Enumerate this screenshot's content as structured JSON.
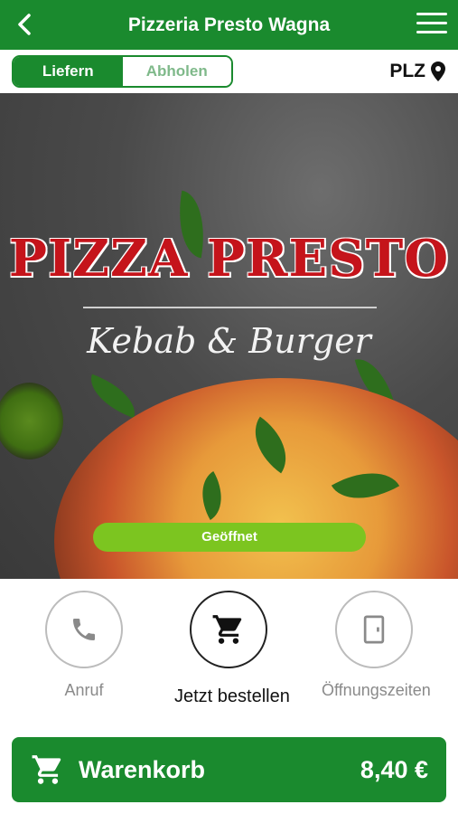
{
  "header": {
    "title": "Pizzeria Presto Wagna",
    "back_icon": "chevron-left-icon",
    "menu_icon": "hamburger-menu-icon"
  },
  "mode_toggle": {
    "options": [
      {
        "label": "Liefern",
        "active": true
      },
      {
        "label": "Abholen",
        "active": false
      }
    ]
  },
  "postal_code": {
    "label": "PLZ",
    "icon": "location-pin-icon"
  },
  "hero": {
    "logo_title": "PIZZA PRESTO",
    "logo_subtitle": "Kebab & Burger",
    "status": "Geöffnet"
  },
  "actions": [
    {
      "label": "Anruf",
      "icon": "phone-icon"
    },
    {
      "label": "Jetzt bestellen",
      "icon": "shopping-cart-icon"
    },
    {
      "label": "Öffnungszeiten",
      "icon": "door-icon"
    }
  ],
  "cart": {
    "label": "Warenkorb",
    "total": "8,40 €",
    "icon": "shopping-cart-icon"
  },
  "colors": {
    "brand_green": "#1a8a2e",
    "status_green": "#7cc520",
    "logo_red": "#c5141b"
  }
}
